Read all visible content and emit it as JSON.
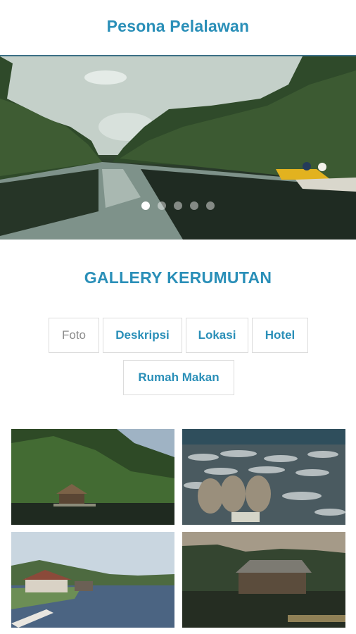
{
  "app": {
    "title": "Pesona Pelalawan"
  },
  "carousel": {
    "slide_count": 5,
    "active_index": 0
  },
  "gallery": {
    "title": "GALLERY KERUMUTAN",
    "tabs": [
      {
        "label": "Foto",
        "active": true
      },
      {
        "label": "Deskripsi",
        "active": false
      },
      {
        "label": "Lokasi",
        "active": false
      },
      {
        "label": "Hotel",
        "active": false
      },
      {
        "label": "Rumah Makan",
        "active": false
      }
    ]
  },
  "colors": {
    "accent": "#2a8fb8",
    "inactive_tab_text": "#8c8c8c",
    "tab_border": "#dcdcdc"
  }
}
